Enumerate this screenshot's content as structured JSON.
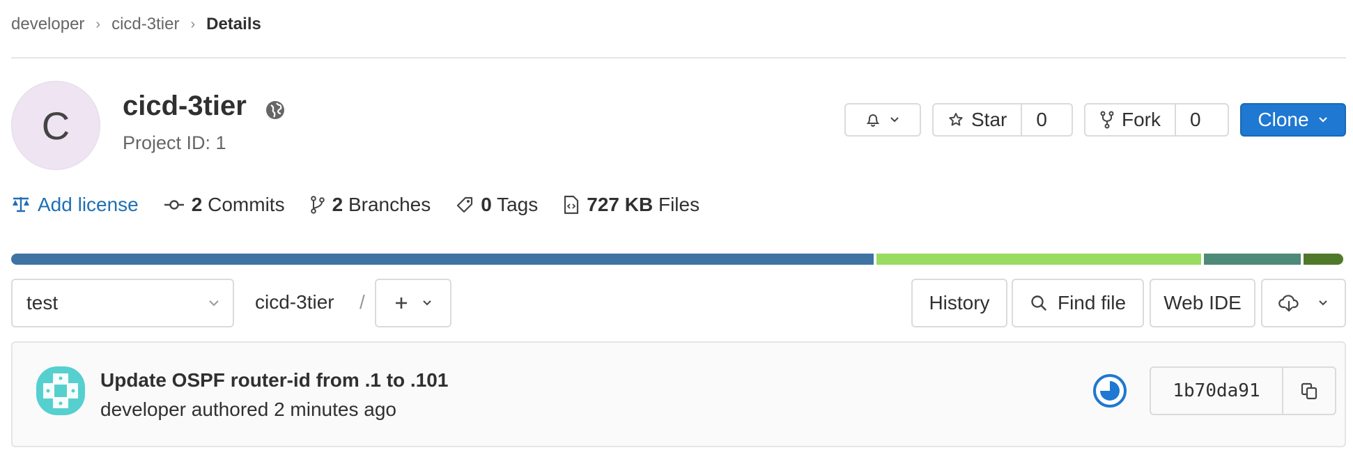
{
  "breadcrumb": {
    "items": [
      "developer",
      "cicd-3tier"
    ],
    "current": "Details"
  },
  "project": {
    "avatar_letter": "C",
    "name": "cicd-3tier",
    "id_label": "Project ID: 1",
    "visibility_icon": "globe-icon"
  },
  "actions": {
    "star_label": "Star",
    "star_count": "0",
    "fork_label": "Fork",
    "fork_count": "0",
    "clone_label": "Clone"
  },
  "stats": {
    "license": "Add license",
    "commits_count": "2",
    "commits_label": "Commits",
    "branches_count": "2",
    "branches_label": "Branches",
    "tags_count": "0",
    "tags_label": "Tags",
    "files_size": "727 KB",
    "files_label": "Files"
  },
  "languages": [
    {
      "color": "#3e73a4",
      "fraction": 0.65
    },
    {
      "color": "#9adb62",
      "fraction": 0.245
    },
    {
      "color": "#4e8a78",
      "fraction": 0.073
    },
    {
      "color": "#50782a",
      "fraction": 0.03
    }
  ],
  "toolbar": {
    "branch": "test",
    "path": "cicd-3tier",
    "path_separator": "/",
    "history": "History",
    "find_file": "Find file",
    "web_ide": "Web IDE"
  },
  "commit": {
    "title": "Update OSPF router-id from .1 to .101",
    "meta": "developer authored 2 minutes ago",
    "sha": "1b70da91"
  },
  "colors": {
    "accent": "#1f78d1",
    "link": "#1f6fb5",
    "pipeline": "#1f78d1",
    "commit_avatar": "#56cfcf"
  }
}
